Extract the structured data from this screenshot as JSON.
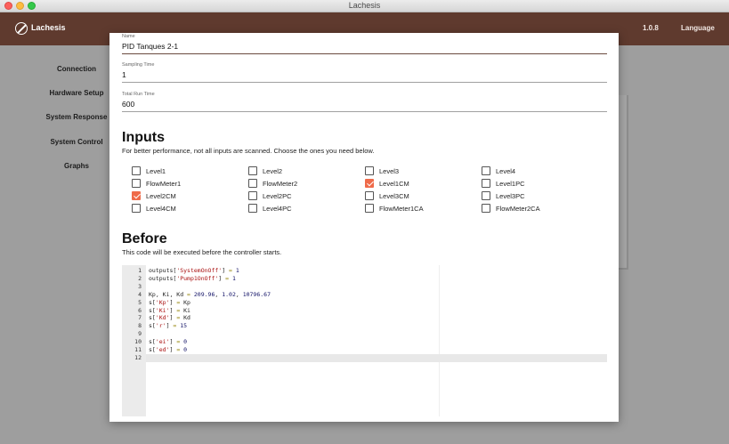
{
  "window": {
    "title": "Lachesis"
  },
  "header": {
    "app_name": "Lachesis",
    "version": "1.0.8",
    "language_label": "Language"
  },
  "sidebar": {
    "items": [
      {
        "label": "Connection"
      },
      {
        "label": "Hardware Setup"
      },
      {
        "label": "System Response"
      },
      {
        "label": "System Control"
      },
      {
        "label": "Graphs"
      }
    ]
  },
  "form": {
    "name": {
      "label": "Name",
      "value": "PID Tanques 2-1"
    },
    "sampling_time": {
      "label": "Sampling Time",
      "value": "1"
    },
    "total_run_time": {
      "label": "Total Run Time",
      "value": "600"
    }
  },
  "inputs": {
    "title": "Inputs",
    "description": "For better performance, not all inputs are scanned. Choose the ones you need below.",
    "rows": [
      [
        {
          "label": "Level1",
          "checked": false
        },
        {
          "label": "Level2",
          "checked": false
        },
        {
          "label": "Level3",
          "checked": false
        },
        {
          "label": "Level4",
          "checked": false
        }
      ],
      [
        {
          "label": "FlowMeter1",
          "checked": false
        },
        {
          "label": "FlowMeter2",
          "checked": false
        },
        {
          "label": "Level1CM",
          "checked": true
        },
        {
          "label": "Level1PC",
          "checked": false
        }
      ],
      [
        {
          "label": "Level2CM",
          "checked": true
        },
        {
          "label": "Level2PC",
          "checked": false
        },
        {
          "label": "Level3CM",
          "checked": false
        },
        {
          "label": "Level3PC",
          "checked": false
        }
      ],
      [
        {
          "label": "Level4CM",
          "checked": false
        },
        {
          "label": "Level4PC",
          "checked": false
        },
        {
          "label": "FlowMeter1CA",
          "checked": false
        },
        {
          "label": "FlowMeter2CA",
          "checked": false
        }
      ]
    ]
  },
  "before": {
    "title": "Before",
    "description": "This code will be executed before the controller starts.",
    "code_lines": [
      "outputs['SystemOnOff'] = 1",
      "outputs['Pump1OnOff'] = 1",
      "",
      "Kp, Ki, Kd = 209.96, 1.02, 10796.67",
      "s['Kp'] = Kp",
      "s['Ki'] = Ki",
      "s['Kd'] = Kd",
      "s['r'] = 15",
      "",
      "s['ei'] = 0",
      "s['ed'] = 0",
      ""
    ]
  }
}
